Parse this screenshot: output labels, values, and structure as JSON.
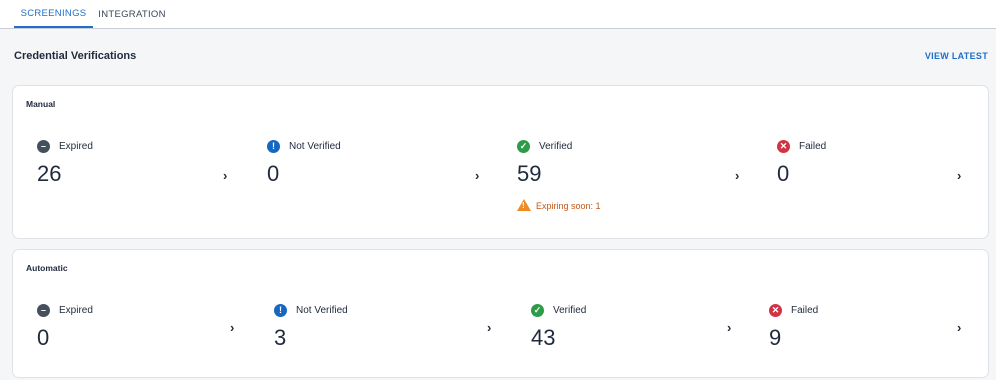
{
  "tabs": [
    {
      "label": "SCREENINGS",
      "active": true
    },
    {
      "label": "INTEGRATION",
      "active": false
    }
  ],
  "section": {
    "title": "Credential Verifications",
    "view_latest": "VIEW LATEST"
  },
  "cards": [
    {
      "title": "Manual",
      "stats": [
        {
          "label": "Expired",
          "value": "26",
          "icon": "minus-circle-icon"
        },
        {
          "label": "Not Verified",
          "value": "0",
          "icon": "exclamation-circle-icon"
        },
        {
          "label": "Verified",
          "value": "59",
          "icon": "check-circle-icon",
          "warning": "Expiring soon: 1"
        },
        {
          "label": "Failed",
          "value": "0",
          "icon": "x-circle-icon"
        }
      ]
    },
    {
      "title": "Automatic",
      "stats": [
        {
          "label": "Expired",
          "value": "0",
          "icon": "minus-circle-icon"
        },
        {
          "label": "Not Verified",
          "value": "3",
          "icon": "exclamation-circle-icon"
        },
        {
          "label": "Verified",
          "value": "43",
          "icon": "check-circle-icon"
        },
        {
          "label": "Failed",
          "value": "9",
          "icon": "x-circle-icon"
        }
      ]
    }
  ],
  "colors": {
    "accent": "#1e6fc9",
    "expired": "#45505f",
    "not_verified": "#1667c2",
    "verified": "#2d9b47",
    "failed": "#d23344",
    "warning": "#c35816"
  }
}
